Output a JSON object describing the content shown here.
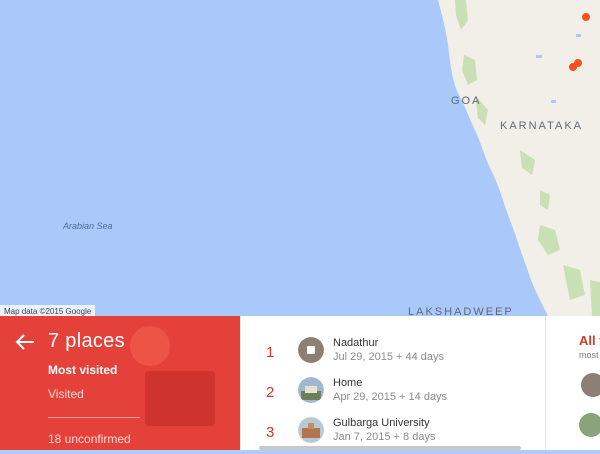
{
  "map": {
    "labels": {
      "goa": "GOA",
      "karnataka": "KARNATAKA",
      "arabian_sea": "Arabian Sea",
      "lakshadweep": "LAKSHADWEEP"
    },
    "attribution": "Map data ©2015 Google",
    "colors": {
      "water": "#a9c9fb",
      "land": "#f2efe9",
      "marker": "#f4511e"
    }
  },
  "sidebar": {
    "title": "7 places",
    "most_visited": "Most visited",
    "visited": "Visited",
    "unconfirmed": "18 unconfirmed",
    "accent": "#e5413b"
  },
  "places": [
    {
      "rank": "1",
      "name": "Nadathur",
      "date": "Jul 29, 2015 + 44 days",
      "icon": "location-marker-icon"
    },
    {
      "rank": "2",
      "name": "Home",
      "date": "Apr 29, 2015 + 14 days",
      "icon": "home-photo-icon"
    },
    {
      "rank": "3",
      "name": "Gulbarga University",
      "date": "Jan 7, 2015 + 8 days",
      "icon": "university-photo-icon"
    }
  ],
  "right_panel": {
    "title": "All t",
    "subtitle": "most"
  }
}
